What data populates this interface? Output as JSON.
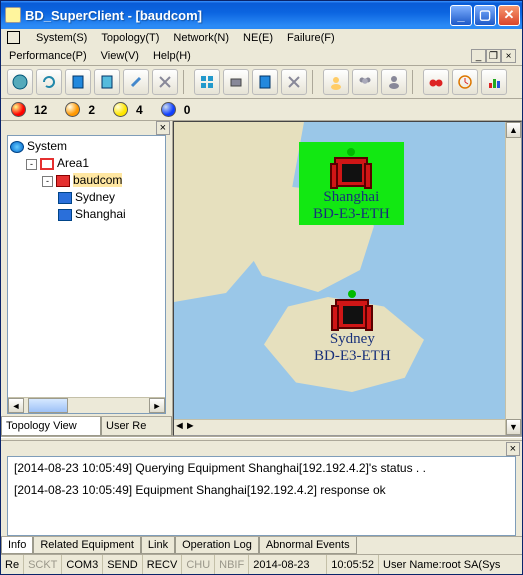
{
  "title": "BD_SuperClient - [baudcom]",
  "menus": {
    "system": "System(S)",
    "topology": "Topology(T)",
    "network": "Network(N)",
    "ne": "NE(E)",
    "failure": "Failure(F)",
    "performance": "Performance(P)",
    "view": "View(V)",
    "help": "Help(H)"
  },
  "alarms": {
    "red": "12",
    "orange": "2",
    "yellow": "4",
    "blue": "0"
  },
  "tree": {
    "root": "System",
    "area": "Area1",
    "group": "baudcom",
    "n1": "Sydney",
    "n2": "Shanghai"
  },
  "left_tabs": {
    "t1": "Topology View",
    "t2": "User Re"
  },
  "nodes": {
    "shanghai": {
      "name": "Shanghai",
      "model": "BD-E3-ETH"
    },
    "sydney": {
      "name": "Sydney",
      "model": "BD-E3-ETH"
    }
  },
  "log": {
    "l1": "[2014-08-23 10:05:49] Querying Equipment Shanghai[192.192.4.2]'s status . .",
    "l2": "[2014-08-23 10:05:49] Equipment Shanghai[192.192.4.2] response ok"
  },
  "log_tabs": {
    "info": "Info",
    "rel": "Related Equipment",
    "link": "Link",
    "op": "Operation Log",
    "ab": "Abnormal Events"
  },
  "status": {
    "re": "Re",
    "sckt": "SCKT",
    "com": "COM3",
    "send": "SEND",
    "recv": "RECV",
    "chu": "CHU",
    "nbif": "NBIF",
    "date": "2014-08-23",
    "time": "10:05:52",
    "user": "User Name:root SA(Sys"
  }
}
